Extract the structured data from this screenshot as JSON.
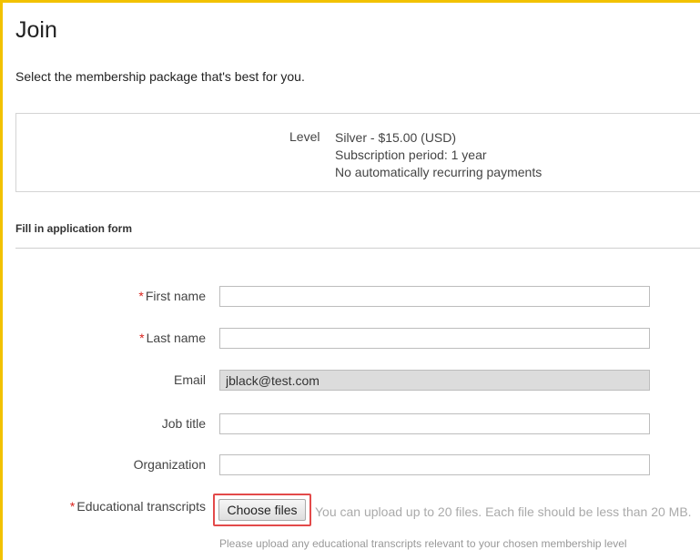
{
  "page": {
    "title": "Join",
    "intro": "Select the membership package that's best for you."
  },
  "package": {
    "level_label": "Level",
    "level_name": "Silver - $15.00 (USD)",
    "subscription_period": "Subscription period: 1 year",
    "recurring": "No automatically recurring payments"
  },
  "form": {
    "section_title": "Fill in application form",
    "required_marker": "*",
    "fields": {
      "first_name": {
        "label": "First name",
        "value": ""
      },
      "last_name": {
        "label": "Last name",
        "value": ""
      },
      "email": {
        "label": "Email",
        "value": "jblack@test.com"
      },
      "job_title": {
        "label": "Job title",
        "value": ""
      },
      "organization": {
        "label": "Organization",
        "value": ""
      }
    },
    "transcripts": {
      "label": "Educational transcripts",
      "button_label": "Choose files",
      "upload_limit": "You can upload up to 20 files. Each file should be less than 20 MB.",
      "help": "Please upload any educational transcripts relevant to your chosen membership level"
    }
  },
  "colors": {
    "frame_border": "#f2c200",
    "required": "#d9221c",
    "highlight": "#e34a4a"
  }
}
